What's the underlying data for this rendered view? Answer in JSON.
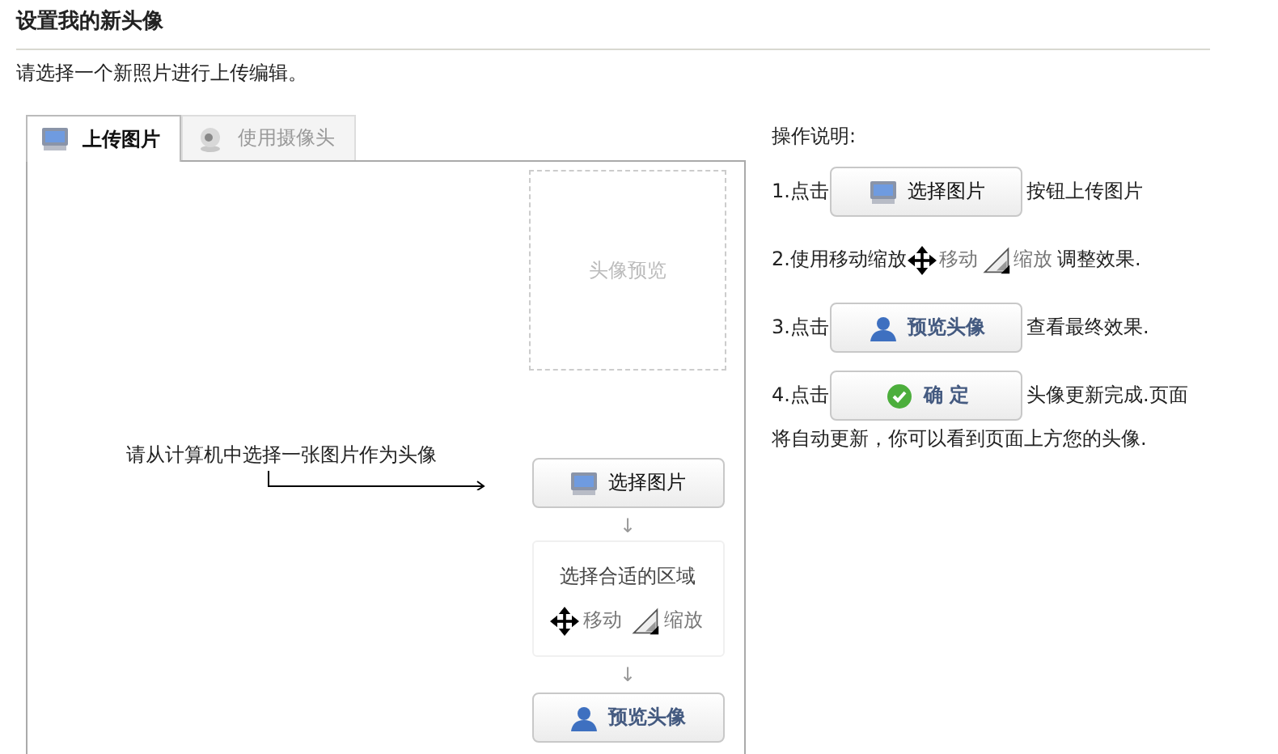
{
  "title": "设置我的新头像",
  "subtitle": "请选择一个新照片进行上传编辑。",
  "tabs": [
    {
      "label": "上传图片",
      "selected": true,
      "kind": "monitor"
    },
    {
      "label": "使用摄像头",
      "selected": false,
      "kind": "webcam"
    }
  ],
  "upload_panel": {
    "preview_label": "头像预览",
    "hint": "请从计算机中选择一张图片作为头像",
    "select_button": "选择图片",
    "down_arrows": [
      "↓",
      "↓"
    ],
    "crop_step": {
      "label": "选择合适的区域",
      "move": "移动",
      "zoom": "缩放"
    },
    "preview_button": "预览头像"
  },
  "instructions": {
    "heading": "操作说明:",
    "steps": [
      {
        "kind": "button",
        "prefix": "1.点击",
        "button": {
          "label": "选择图片",
          "kind": "monitor"
        },
        "suffix": "按钮上传图片"
      },
      {
        "kind": "tools",
        "prefix": "2.使用移动缩放",
        "move": "移动",
        "zoom": "缩放",
        "suffix": "调整效果."
      },
      {
        "kind": "button",
        "prefix": "3.点击",
        "button": {
          "label": "预览头像",
          "kind": "user"
        },
        "suffix": "查看最终效果."
      },
      {
        "kind": "button",
        "prefix": "4.点击",
        "button": {
          "label": "确 定",
          "kind": "check"
        },
        "suffix": "头像更新完成.页面",
        "continuation": "将自动更新，你可以看到页面上方您的头像."
      }
    ]
  }
}
